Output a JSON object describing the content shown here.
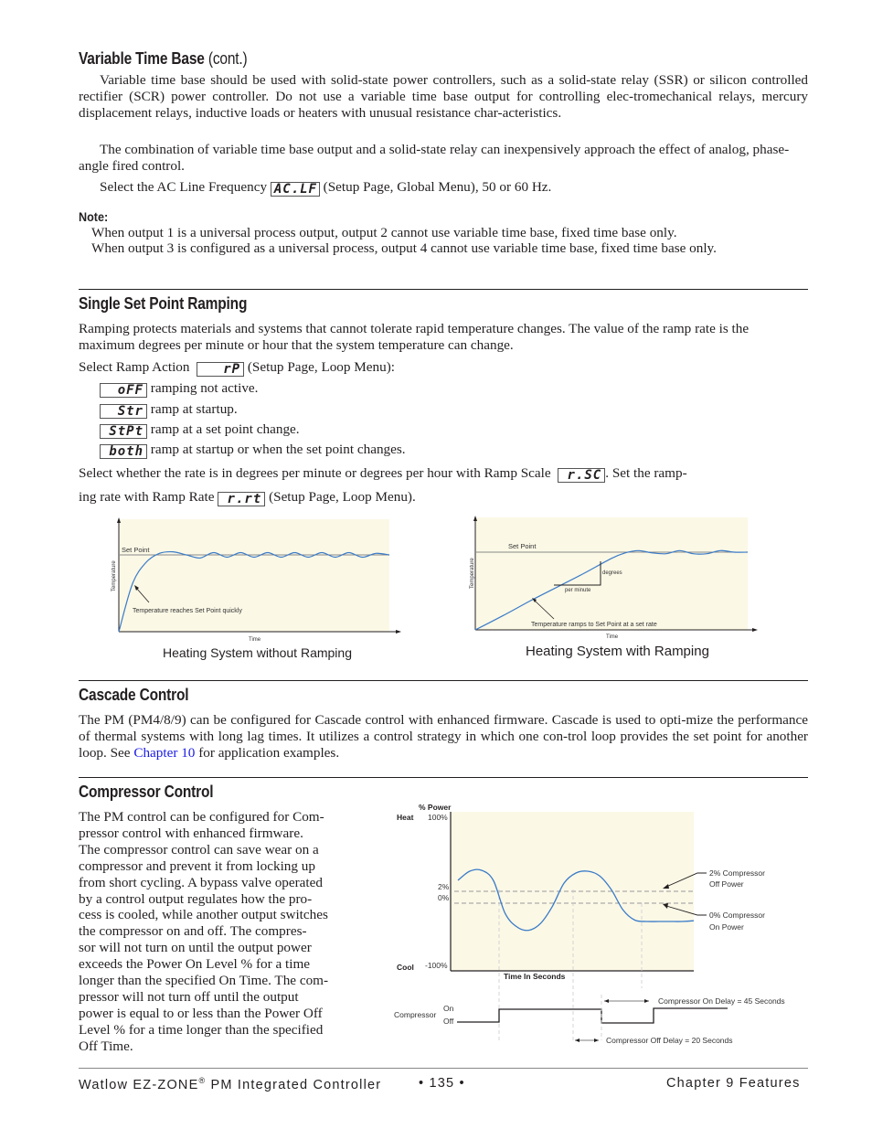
{
  "sections": {
    "variable_time_base": {
      "heading": "Variable Time Base ",
      "heading_suffix": "(cont.)",
      "para1": "Variable time base should be used with solid-state power controllers, such as a solid-state relay (SSR) or silicon controlled rectifier (SCR) power controller. Do not use a variable time base output for controlling elec-tromechanical relays, mercury displacement relays, inductive loads or heaters with unusual resistance char-acteristics.",
      "para2": "The combination of variable time base output and a solid-state relay can inexpensively approach the effect of analog, phase-angle fired control.",
      "para3_prefix": "Select the AC Line Frequency",
      "para3_code": "AC.LF",
      "para3_suffix": "(Setup Page, Global Menu), 50 or 60 Hz.",
      "note_label": "Note:",
      "note_lines": [
        "When output 1 is a universal process output, output 2 cannot use variable time base, fixed time base only.",
        "When output 3 is configured as a universal process, output 4 cannot use variable time base, fixed time base only."
      ]
    },
    "single_set_point_ramping": {
      "heading": "Single Set Point Ramping",
      "intro": "Ramping protects materials and systems that cannot tolerate rapid temperature changes. The value of the ramp rate is the maximum degrees per minute or hour that the system temperature can change.",
      "select_prefix": "Select Ramp Action",
      "select_code": "rP",
      "select_suffix": "(Setup Page, Loop Menu):",
      "options": [
        {
          "code": "oFF",
          "text": "ramping not active."
        },
        {
          "code": "Str",
          "text": "ramp at startup."
        },
        {
          "code": "StPt",
          "text": "ramp at a set point change."
        },
        {
          "code": "both",
          "text": "ramp at startup or when the set point changes."
        }
      ],
      "scale_prefix": "Select whether the rate is in degrees per minute or degrees per hour with Ramp Scale",
      "scale_code": "r.SC",
      "scale_suffix": ". Set the ramp-",
      "rate_prefix": "ing rate with Ramp Rate",
      "rate_code": "r.rt",
      "rate_suffix": "(Setup Page, Loop Menu)."
    },
    "cascade_control": {
      "heading": "Cascade Control",
      "text_before_link": "The PM (PM4/8/9) can be configured for Cascade control with enhanced firmware. Cascade is used to opti-mize the performance of thermal systems with long lag times. It utilizes a control strategy in which one con-trol loop provides the set point for another loop. See ",
      "link": "Chapter 10",
      "text_after_link": " for application examples."
    },
    "compressor_control": {
      "heading": "Compressor Control",
      "lines": [
        "The PM control can be configured for Com-",
        "pressor control with enhanced firmware.",
        "The compressor control can save wear on a",
        "compressor and prevent it from locking up",
        "from short cycling. A bypass valve operated",
        "by a control output regulates how the pro-",
        "cess is cooled, while another output switches",
        "the compressor on and off. The compres-",
        "sor will not turn on until the output power",
        "exceeds the Power On Level % for a time",
        "longer than the specified On Time. The com-",
        "pressor will not turn off until the output",
        "power is equal to or less than the Power Off",
        "Level % for a time longer than the specified",
        "Off Time."
      ]
    }
  },
  "chart_data": [
    {
      "type": "line",
      "title": "Heating System without Ramping",
      "xlabel": "Time",
      "ylabel": "Temperature",
      "reference_line": "Set Point",
      "annotation": "Temperature reaches Set Point quickly",
      "description": "Temperature rises rapidly to set point then oscillates around it",
      "series": [
        {
          "name": "Temperature",
          "x": [
            0,
            0.05,
            0.1,
            0.15,
            0.2,
            0.25,
            0.3,
            0.35,
            0.4,
            0.45,
            0.5,
            0.55,
            0.6,
            0.65,
            0.7,
            0.75,
            0.8,
            0.85,
            0.9,
            0.95,
            1.0
          ],
          "y": [
            0,
            0.62,
            0.9,
            1.02,
            1.04,
            1.0,
            0.96,
            1.03,
            0.97,
            1.03,
            0.97,
            1.03,
            0.97,
            1.03,
            0.97,
            1.03,
            0.97,
            1.03,
            0.97,
            1.02,
            1.0
          ]
        }
      ],
      "setpoint": 1.0
    },
    {
      "type": "line",
      "title": "Heating System with Ramping",
      "xlabel": "Time",
      "ylabel": "Temperature",
      "reference_line": "Set Point",
      "annotations": [
        "Temperature ramps to Set Point at a set rate",
        "degrees",
        "per minute"
      ],
      "description": "Temperature rises linearly to set point then oscillates slightly",
      "series": [
        {
          "name": "Temperature",
          "x": [
            0,
            0.1,
            0.2,
            0.3,
            0.4,
            0.5,
            0.55,
            0.6,
            0.65,
            0.7,
            0.75,
            0.8,
            0.85,
            0.9,
            0.95,
            1.0
          ],
          "y": [
            0,
            0.18,
            0.37,
            0.55,
            0.73,
            0.92,
            0.99,
            1.02,
            0.99,
            0.98,
            1.02,
            0.98,
            0.98,
            1.02,
            1.0,
            1.0
          ]
        }
      ],
      "setpoint": 1.0
    },
    {
      "type": "line",
      "title": "",
      "ylabel": "% Power",
      "xlabel": "Time In Seconds",
      "y_top_label": "Heat",
      "y_bottom_label": "Cool",
      "yticks": [
        "100%",
        "2%",
        "0%",
        "-100%"
      ],
      "ylim": [
        -100,
        100
      ],
      "reference_lines": [
        {
          "value": 2,
          "label": "2% Compressor Off Power"
        },
        {
          "value": 0,
          "label": "0% Compressor On Power"
        }
      ],
      "series": [
        {
          "name": "% Power",
          "x": [
            0,
            0.05,
            0.1,
            0.15,
            0.2,
            0.25,
            0.3,
            0.35,
            0.4,
            0.45,
            0.5,
            0.55,
            0.6,
            0.65,
            0.7,
            0.75,
            0.8,
            0.85,
            0.9,
            0.95,
            1.0
          ],
          "y": [
            25,
            35,
            36,
            25,
            -15,
            -35,
            -40,
            -30,
            -5,
            22,
            33,
            35,
            30,
            15,
            -10,
            -25,
            -27,
            -27,
            -27,
            -27,
            -26
          ]
        }
      ],
      "compressor": {
        "label": "Compressor",
        "states": [
          "On",
          "Off"
        ],
        "on_delay_label": "Compressor On Delay = 45 Seconds",
        "off_delay_label": "Compressor Off Delay = 20 Seconds"
      }
    }
  ],
  "footer": {
    "left": "Watlow EZ-ZONE",
    "reg": "®",
    "left_suffix": " PM Integrated Controller",
    "page": "•  135  •",
    "right": "Chapter 9 Features"
  }
}
